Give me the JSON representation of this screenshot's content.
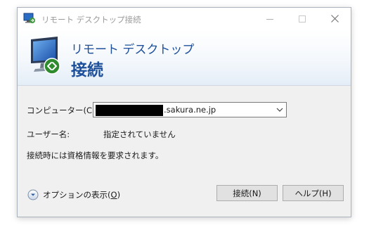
{
  "window": {
    "title": "リモート デスクトップ接続"
  },
  "header": {
    "line1": "リモート デスクトップ",
    "line2": "接続"
  },
  "form": {
    "computer_label": "コンピューター(C):",
    "computer_value": ".sakura.ne.jp",
    "user_label": "ユーザー名:",
    "user_value": "指定されていません",
    "info_text": "接続時には資格情報を要求されます。"
  },
  "footer": {
    "options_label_prefix": "オプションの表示(",
    "options_label_key": "O",
    "options_label_suffix": ")",
    "connect_button": "接続(N)",
    "help_button": "ヘルプ(H)"
  },
  "colors": {
    "accent": "#1e4f9a",
    "redaction": "#000000"
  },
  "icons": {
    "app": "remote-desktop-icon",
    "header": "remote-desktop-monitor-icon",
    "combo": "chevron-down-icon",
    "options": "expand-circle-icon"
  }
}
